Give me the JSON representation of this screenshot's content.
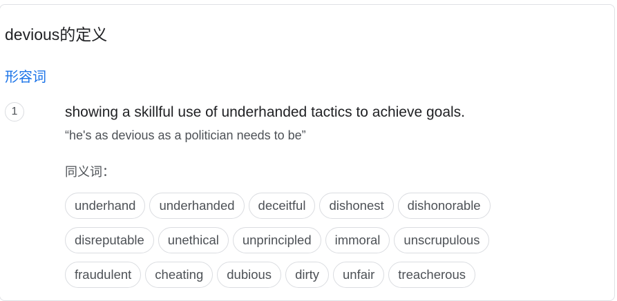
{
  "title": "devious的定义",
  "part_of_speech": "形容词",
  "sense": {
    "number": "1",
    "definition": "showing a skillful use of underhanded tactics to achieve goals.",
    "example": "“he's as devious as a politician needs to be”"
  },
  "synonyms_label": "同义词：",
  "synonyms": {
    "row1": [
      "underhand",
      "underhanded",
      "deceitful",
      "dishonest",
      "dishonorable"
    ],
    "row2": [
      "disreputable",
      "unethical",
      "unprincipled",
      "immoral",
      "unscrupulous"
    ],
    "row3": [
      "fraudulent",
      "cheating",
      "dubious",
      "dirty",
      "unfair",
      "treacherous"
    ]
  }
}
